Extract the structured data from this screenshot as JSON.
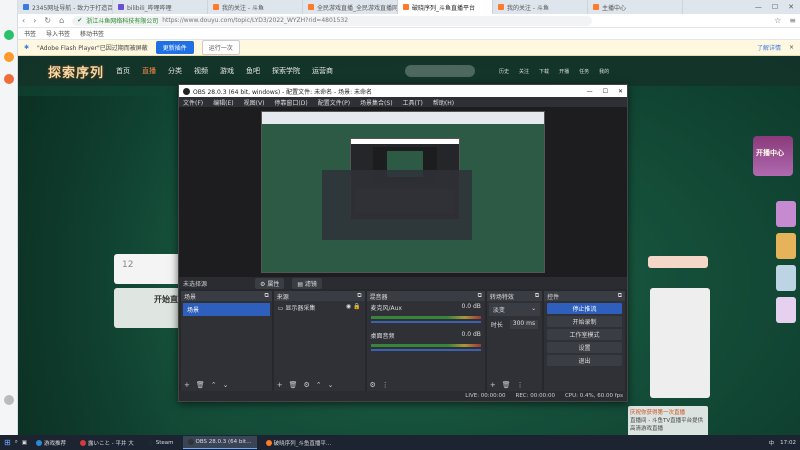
{
  "browser": {
    "tabs": [
      {
        "label": "2345网址导航 - 致力于打造百年…",
        "color": "#3b7be0"
      },
      {
        "label": "bilibili_哔哩哔哩",
        "color": "#6a4fd6"
      },
      {
        "label": "我的关注 - 斗鱼",
        "color": "#ff7a2a"
      },
      {
        "label": "全民游戏直播_全民游戏直播网站",
        "color": "#ff7a2a"
      },
      {
        "label": "破晓序列_斗鱼直播平台",
        "color": "#ff7a2a",
        "active": true
      },
      {
        "label": "我的关注 - 斗鱼",
        "color": "#ff7a2a"
      },
      {
        "label": "主播中心",
        "color": "#ff7a2a"
      }
    ],
    "url_site": "浙江斗鱼网络科技有限公司",
    "url_path": "https://www.douyu.com/topic/LYD3/2022_WYZH?rid=4801532",
    "bookmarks": [
      "书签",
      "导入书签",
      "移动书签"
    ],
    "flash_notice": "\"Adobe Flash Player\"已因过期而被屏蔽",
    "flash_update_button": "更新插件",
    "flash_once_button": "运行一次",
    "flash_right_link": "了解详情"
  },
  "douyu": {
    "logo": "探索序列",
    "nav": [
      "首页",
      "直播",
      "分类",
      "视频",
      "游戏",
      "鱼吧",
      "探索学院",
      "运营商"
    ],
    "nav_hot_index": 1,
    "header_icons": [
      "历史",
      "关注",
      "下载",
      "开播",
      "任务",
      "我的"
    ],
    "left_card_num": "12",
    "left_promo": "开始直播",
    "right_badge": "开播中心",
    "side_promo_title": "庆祝你获得第一次直播",
    "side_chat_line": "直播间 - 斗鱼TV直播平台提供高清游戏直播"
  },
  "obs": {
    "title": "OBS 28.0.3 (64 bit, windows) - 配置文件: 未命名 - 场景: 未命名",
    "menu": [
      "文件(F)",
      "编辑(E)",
      "视图(V)",
      "停靠窗口(D)",
      "配置文件(P)",
      "场景集合(S)",
      "工具(T)",
      "帮助(H)"
    ],
    "no_source": "未选择源",
    "props_btn": "属性",
    "filters_btn": "滤镜",
    "scenes_title": "场景",
    "scene_item": "场景",
    "sources_title": "来源",
    "source_item": "显示器采集",
    "mixer_title": "混音器",
    "mixer_channels": [
      {
        "name": "麦克风/Aux",
        "db": "0.0 dB"
      },
      {
        "name": "桌面音频",
        "db": "0.0 dB"
      }
    ],
    "transitions_title": "转场特效",
    "transition_type": "淡变",
    "duration_label": "时长",
    "duration_value": "300 ms",
    "controls_title": "控件",
    "controls": [
      "停止推流",
      "开始录制",
      "工作室模式",
      "设置",
      "退出"
    ],
    "status_live": "LIVE: 00:00:00",
    "status_rec": "REC: 00:00:00",
    "status_cpu": "CPU: 0.4%, 60.00 fps"
  },
  "taskbar": {
    "items": [
      {
        "label": "游戏推荐",
        "color": "#2a8ad6"
      },
      {
        "label": "露いこと - 平井 大",
        "color": "#d63a3a"
      },
      {
        "label": "Steam",
        "color": "#1b2838"
      },
      {
        "label": "OBS 28.0.3 (64 bit…",
        "color": "#333333",
        "active": true
      },
      {
        "label": "破晓序列_斗鱼直播平…",
        "color": "#ff7a2a"
      }
    ],
    "ime": "中",
    "time": "17:02"
  }
}
